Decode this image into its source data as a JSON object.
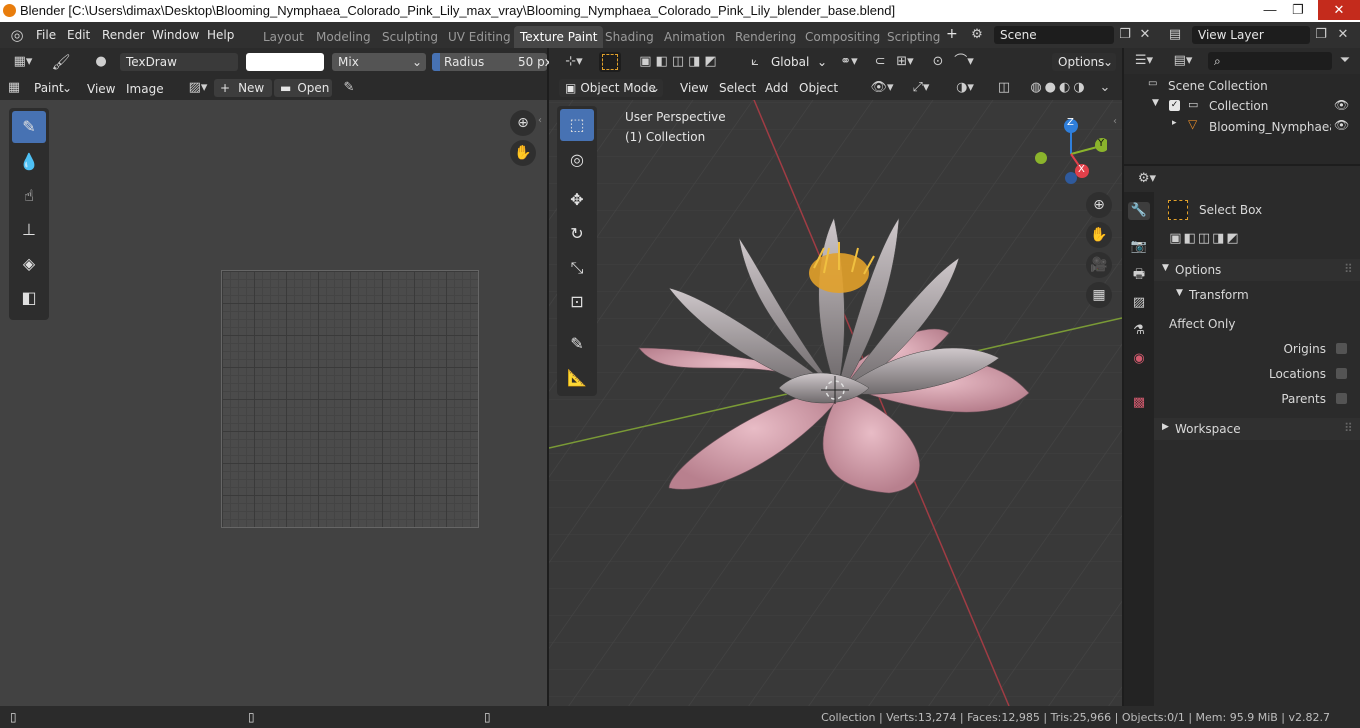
{
  "window": {
    "title": "Blender [C:\\Users\\dimax\\Desktop\\Blooming_Nymphaea_Colorado_Pink_Lily_max_vray\\Blooming_Nymphaea_Colorado_Pink_Lily_blender_base.blend]",
    "minimize": "—",
    "maximize": "❐",
    "close": "✕"
  },
  "menu": {
    "file": "File",
    "edit": "Edit",
    "render": "Render",
    "window": "Window",
    "help": "Help"
  },
  "workspaces": [
    "Layout",
    "Modeling",
    "Sculpting",
    "UV Editing",
    "Texture Paint",
    "Shading",
    "Animation",
    "Rendering",
    "Compositing",
    "Scripting"
  ],
  "active_workspace": "Texture Paint",
  "add_workspace": "+",
  "scene": {
    "label": "Scene",
    "view_layer": "View Layer"
  },
  "image_editor": {
    "brush_name": "TexDraw",
    "blend_mode": "Mix",
    "radius_label": "Radius",
    "radius_value": "50 px",
    "mode": "Paint",
    "view": "View",
    "image": "Image",
    "new": "New",
    "open": "Open"
  },
  "viewport": {
    "transform_orientation": "Global",
    "options": "Options",
    "mode": "Object Mode",
    "view": "View",
    "select": "Select",
    "add": "Add",
    "object": "Object",
    "perspective": "User Perspective",
    "collection": "(1) Collection",
    "axes": {
      "x": "X",
      "y": "Y",
      "z": "Z"
    }
  },
  "outliner": {
    "scene_collection": "Scene Collection",
    "collection": "Collection",
    "object": "Blooming_Nymphaea_Co"
  },
  "properties": {
    "tool": "Select Box",
    "options": "Options",
    "transform": "Transform",
    "affect_only": "Affect Only",
    "origins": "Origins",
    "locations": "Locations",
    "parents": "Parents",
    "workspace": "Workspace"
  },
  "status": {
    "text": "Collection | Verts:13,274 | Faces:12,985 | Tris:25,966 | Objects:0/1 | Mem: 95.9 MiB | v2.82.7"
  },
  "colors": {
    "accent": "#4772b3",
    "x_axis": "#e2404a",
    "y_axis": "#8bb42c",
    "z_axis": "#2f7fdc",
    "petal_pink": "#d9a4b0",
    "stamen": "#e2a12a"
  }
}
